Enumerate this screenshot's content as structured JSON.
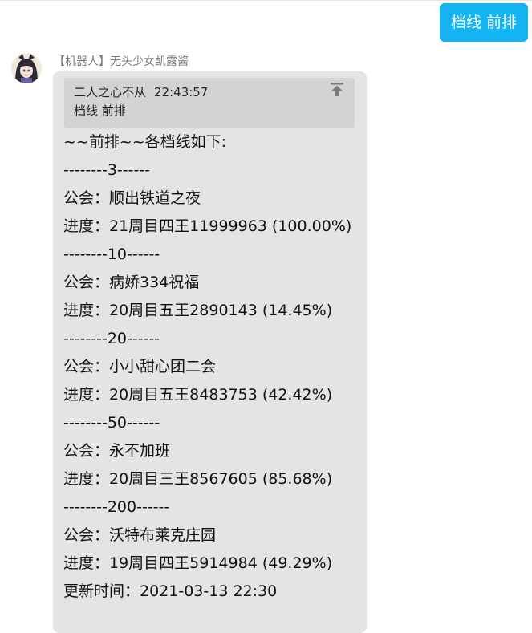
{
  "outgoing": {
    "text": "档线 前排"
  },
  "incoming": {
    "sender": "【机器人】无头少女凯露酱",
    "quote": {
      "author": "二人之心不从",
      "time": "22:43:57",
      "text": "档线 前排"
    },
    "lines": [
      "~~前排~~各档线如下:",
      "--------3------",
      "公会：顺出铁道之夜",
      "进度：21周目四王11999963 (100.00%)",
      "--------10------",
      "公会：病娇334祝福",
      "进度：20周目五王2890143 (14.45%)",
      "--------20------",
      "公会：小小甜心团二会",
      "进度：20周目五王8483753 (42.42%)",
      "--------50------",
      "公会：永不加班",
      "进度：20周目三王8567605 (85.68%)",
      "--------200------",
      "公会：沃特布莱克庄园",
      "进度：19周目四王5914984 (49.29%)",
      "更新时间：2021-03-13 22:30"
    ]
  },
  "colors": {
    "sent_bubble": "#14b4f2",
    "received_bubble": "#e4e4e4",
    "quote_background": "#d3d3d3",
    "sender_name": "#7a7a7a"
  },
  "icons": {
    "avatar": "anime-girl-avatar",
    "quote_jump": "arrow-up-to-top-icon"
  }
}
